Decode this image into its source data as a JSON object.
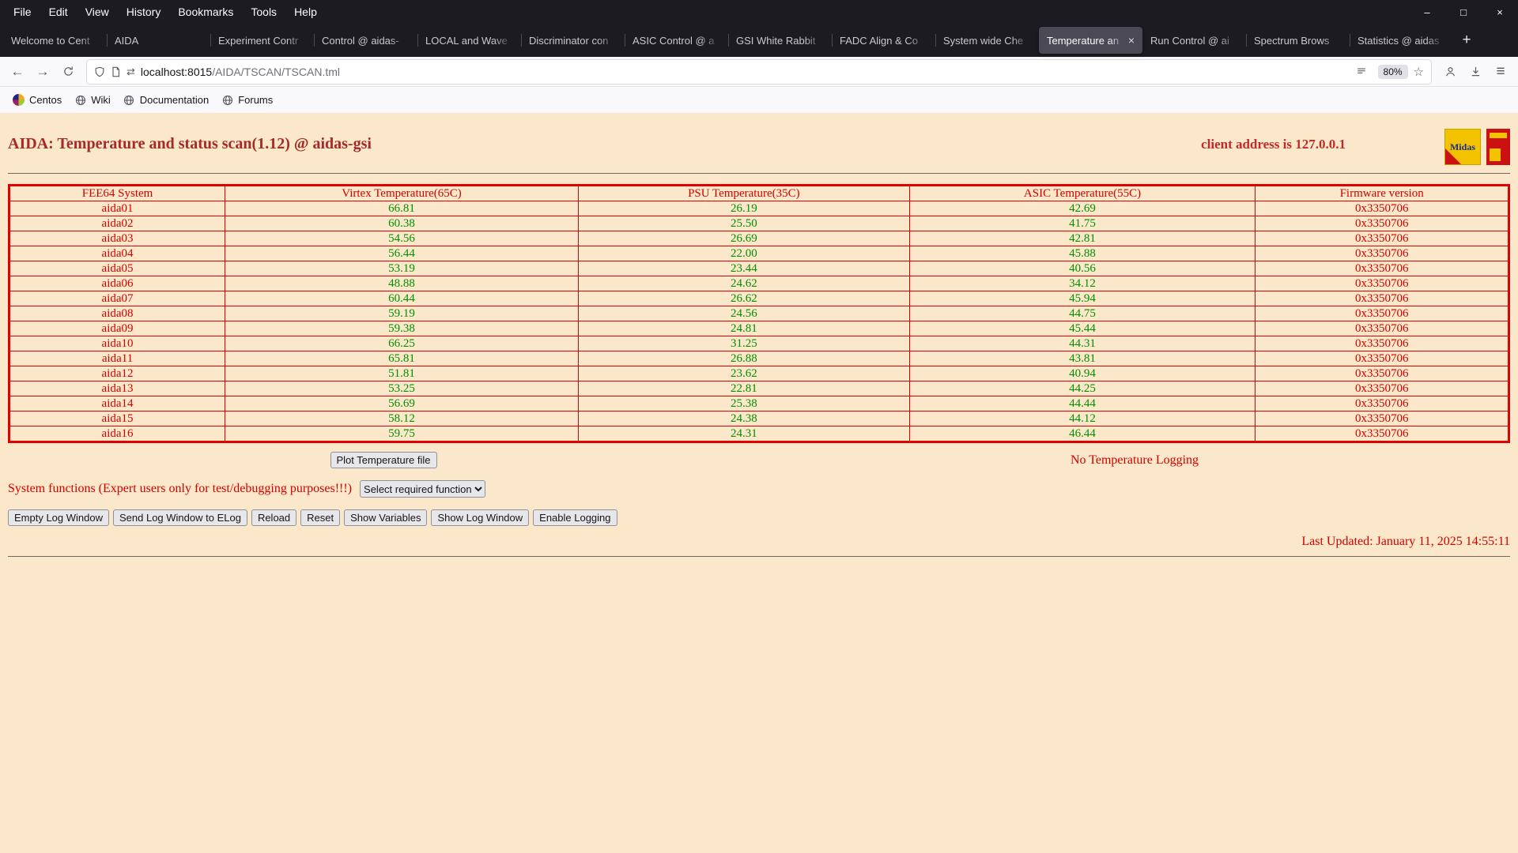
{
  "titlebar": {
    "menu": [
      "File",
      "Edit",
      "View",
      "History",
      "Bookmarks",
      "Tools",
      "Help"
    ]
  },
  "icons": {
    "minimize": "–",
    "maximize": "□",
    "window_close": "×",
    "back": "←",
    "forward": "→",
    "connection": "⇄",
    "star": "☆",
    "menu": "≡",
    "tab_close": "×"
  },
  "tabs": {
    "items": [
      {
        "label": "Welcome to Cent",
        "active": false
      },
      {
        "label": "AIDA",
        "active": false
      },
      {
        "label": "Experiment Contr",
        "active": false
      },
      {
        "label": "Control @ aidas-",
        "active": false
      },
      {
        "label": "LOCAL and Wave",
        "active": false
      },
      {
        "label": "Discriminator con",
        "active": false
      },
      {
        "label": "ASIC Control @ a",
        "active": false
      },
      {
        "label": "GSI White Rabbit",
        "active": false
      },
      {
        "label": "FADC Align & Co",
        "active": false
      },
      {
        "label": "System wide Che",
        "active": false
      },
      {
        "label": "Temperature an",
        "active": true
      },
      {
        "label": "Run Control @ ai",
        "active": false
      },
      {
        "label": "Spectrum Brows",
        "active": false
      },
      {
        "label": "Statistics @ aidas",
        "active": false
      }
    ],
    "new_tab_label": "+"
  },
  "navbar": {
    "url_host": "localhost:8015",
    "url_path": "/AIDA/TSCAN/TSCAN.tml",
    "zoom_level": "80%"
  },
  "bookmarks": [
    "Centos",
    "Wiki",
    "Documentation",
    "Forums"
  ],
  "page": {
    "title": "AIDA: Temperature and status scan(1.12) @ aidas-gsi",
    "client_address": "client address is 127.0.0.1",
    "midas_logo_text": "Midas",
    "table": {
      "headers": [
        "FEE64 System",
        "Virtex Temperature(65C)",
        "PSU Temperature(35C)",
        "ASIC Temperature(55C)",
        "Firmware version"
      ],
      "rows": [
        [
          "aida01",
          "66.81",
          "26.19",
          "42.69",
          "0x3350706"
        ],
        [
          "aida02",
          "60.38",
          "25.50",
          "41.75",
          "0x3350706"
        ],
        [
          "aida03",
          "54.56",
          "26.69",
          "42.81",
          "0x3350706"
        ],
        [
          "aida04",
          "56.44",
          "22.00",
          "45.88",
          "0x3350706"
        ],
        [
          "aida05",
          "53.19",
          "23.44",
          "40.56",
          "0x3350706"
        ],
        [
          "aida06",
          "48.88",
          "24.62",
          "34.12",
          "0x3350706"
        ],
        [
          "aida07",
          "60.44",
          "26.62",
          "45.94",
          "0x3350706"
        ],
        [
          "aida08",
          "59.19",
          "24.56",
          "44.75",
          "0x3350706"
        ],
        [
          "aida09",
          "59.38",
          "24.81",
          "45.44",
          "0x3350706"
        ],
        [
          "aida10",
          "66.25",
          "31.25",
          "44.31",
          "0x3350706"
        ],
        [
          "aida11",
          "65.81",
          "26.88",
          "43.81",
          "0x3350706"
        ],
        [
          "aida12",
          "51.81",
          "23.62",
          "40.94",
          "0x3350706"
        ],
        [
          "aida13",
          "53.25",
          "22.81",
          "44.25",
          "0x3350706"
        ],
        [
          "aida14",
          "56.69",
          "25.38",
          "44.44",
          "0x3350706"
        ],
        [
          "aida15",
          "58.12",
          "24.38",
          "44.12",
          "0x3350706"
        ],
        [
          "aida16",
          "59.75",
          "24.31",
          "46.44",
          "0x3350706"
        ]
      ]
    },
    "plot_button": "Plot Temperature file",
    "logging_status": "No Temperature Logging",
    "system_functions_label": "System functions (Expert users only for test/debugging purposes!!!)",
    "function_select_value": "Select required function",
    "action_buttons": [
      "Empty Log Window",
      "Send Log Window to ELog",
      "Reload",
      "Reset",
      "Show Variables",
      "Show Log Window",
      "Enable Logging"
    ],
    "last_updated": "Last Updated: January 11, 2025 14:55:11"
  }
}
